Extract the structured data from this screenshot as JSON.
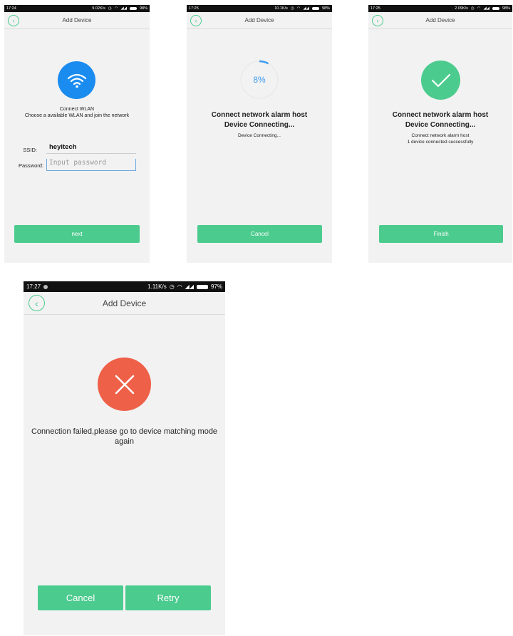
{
  "screens": {
    "s1": {
      "status": {
        "time": "17:24",
        "speed": "9.02K/s",
        "battery": "98%"
      },
      "header_title": "Add Device",
      "wifi_title": "Connect WLAN",
      "wifi_subtitle": "Choose a available WLAN and join the network",
      "ssid_label": "SSID:",
      "ssid_value": "heyitech",
      "password_label": "Password:",
      "password_placeholder": "Input password",
      "next_button": "next"
    },
    "s2": {
      "status": {
        "time": "17:25",
        "speed": "10.1K/s",
        "battery": "98%"
      },
      "header_title": "Add Device",
      "progress_percent": "8%",
      "progress_value": 0.08,
      "title_line1": "Connect network alarm host",
      "title_line2": "Device Connecting...",
      "subtitle": "Device Connecting...",
      "cancel_button": "Cancel"
    },
    "s3": {
      "status": {
        "time": "17:25",
        "speed": "2.09K/s",
        "battery": "98%"
      },
      "header_title": "Add Device",
      "title_line1": "Connect network alarm host",
      "title_line2": "Device Connecting...",
      "sub_line1": "Connect network alarm host",
      "sub_line2": "1 device connected successfully",
      "finish_button": "Finish"
    },
    "s4": {
      "status": {
        "time": "17:27",
        "speed": "1.11K/s",
        "battery": "97%"
      },
      "header_title": "Add Device",
      "message_line1": "Connection failed,please go to device matching mode",
      "message_line2": "again",
      "cancel_button": "Cancel",
      "retry_button": "Retry"
    }
  },
  "colors": {
    "accent_green": "#4ccb8e",
    "wifi_blue": "#1a8cf0",
    "error_red": "#ee6048",
    "progress_blue": "#3d9bf0"
  }
}
